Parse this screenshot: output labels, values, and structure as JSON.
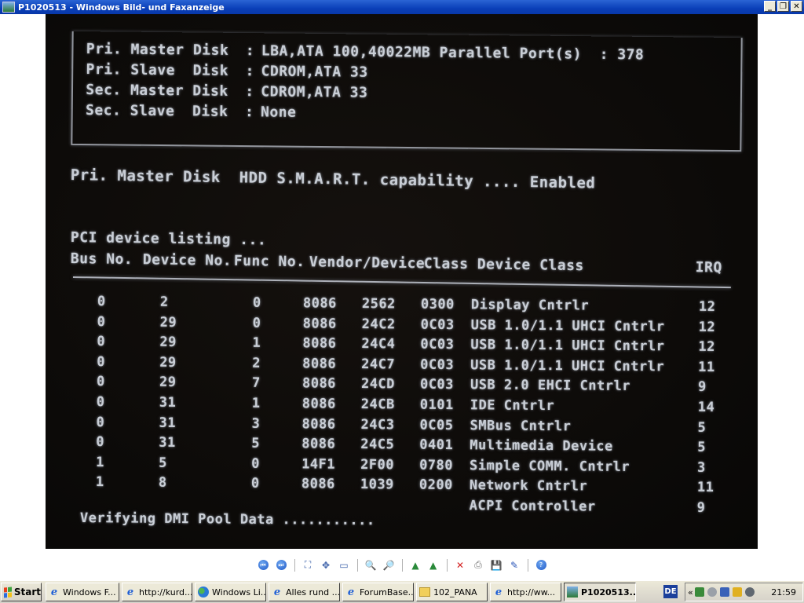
{
  "window": {
    "title": "P1020513 - Windows Bild- und Faxanzeige",
    "buttons": [
      "_",
      "❐",
      "✕"
    ]
  },
  "photo": {
    "disk_rows": [
      {
        "label": "Pri. Master Disk",
        "sep": ":",
        "value": "LBA,ATA 100,40022MB Parallel Port(s)  : 378"
      },
      {
        "label": "Pri. Slave  Disk",
        "sep": ":",
        "value": "CDROM,ATA 33"
      },
      {
        "label": "Sec. Master Disk",
        "sep": ":",
        "value": "CDROM,ATA 33"
      },
      {
        "label": "Sec. Slave  Disk",
        "sep": ":",
        "value": "None"
      }
    ],
    "smart_line": "Pri. Master Disk  HDD S.M.A.R.T. capability .... Enabled",
    "pci_heading": "PCI device listing ...",
    "columns": [
      "Bus No.",
      "Device No.",
      "Func No.",
      "Vendor/Device",
      "Class",
      "Device Class",
      "IRQ"
    ],
    "pci_rows": [
      {
        "bus": "0",
        "dev": "2",
        "func": "0",
        "vendor": "8086",
        "device": "2562",
        "class": "0300",
        "name": "Display Cntrlr",
        "irq": "12"
      },
      {
        "bus": "0",
        "dev": "29",
        "func": "0",
        "vendor": "8086",
        "device": "24C2",
        "class": "0C03",
        "name": "USB 1.0/1.1 UHCI Cntrlr",
        "irq": "12"
      },
      {
        "bus": "0",
        "dev": "29",
        "func": "1",
        "vendor": "8086",
        "device": "24C4",
        "class": "0C03",
        "name": "USB 1.0/1.1 UHCI Cntrlr",
        "irq": "12"
      },
      {
        "bus": "0",
        "dev": "29",
        "func": "2",
        "vendor": "8086",
        "device": "24C7",
        "class": "0C03",
        "name": "USB 1.0/1.1 UHCI Cntrlr",
        "irq": "11"
      },
      {
        "bus": "0",
        "dev": "29",
        "func": "7",
        "vendor": "8086",
        "device": "24CD",
        "class": "0C03",
        "name": "USB 2.0 EHCI Cntrlr",
        "irq": "9"
      },
      {
        "bus": "0",
        "dev": "31",
        "func": "1",
        "vendor": "8086",
        "device": "24CB",
        "class": "0101",
        "name": "IDE Cntrlr",
        "irq": "14"
      },
      {
        "bus": "0",
        "dev": "31",
        "func": "3",
        "vendor": "8086",
        "device": "24C3",
        "class": "0C05",
        "name": "SMBus Cntrlr",
        "irq": "5"
      },
      {
        "bus": "0",
        "dev": "31",
        "func": "5",
        "vendor": "8086",
        "device": "24C5",
        "class": "0401",
        "name": "Multimedia Device",
        "irq": "5"
      },
      {
        "bus": "1",
        "dev": "5",
        "func": "0",
        "vendor": "14F1",
        "device": "2F00",
        "class": "0780",
        "name": "Simple COMM. Cntrlr",
        "irq": "3"
      },
      {
        "bus": "1",
        "dev": "8",
        "func": "0",
        "vendor": "8086",
        "device": "1039",
        "class": "0200",
        "name": "Network Cntrlr",
        "irq": "11"
      },
      {
        "bus": "",
        "dev": "",
        "func": "",
        "vendor": "",
        "device": "",
        "class": "",
        "name": "ACPI Controller",
        "irq": "9"
      }
    ],
    "verify_line": "Verifying DMI Pool Data ..........."
  },
  "viewer_toolbar": {
    "icons": [
      {
        "name": "previous-image-icon",
        "glyph": "⏮"
      },
      {
        "name": "next-image-icon",
        "glyph": "⏭"
      },
      {
        "sep": true
      },
      {
        "name": "best-fit-icon",
        "glyph": "⛶"
      },
      {
        "name": "actual-size-icon",
        "glyph": "✥"
      },
      {
        "name": "slideshow-icon",
        "glyph": "▭"
      },
      {
        "sep": true
      },
      {
        "name": "zoom-in-icon",
        "glyph": "🔍"
      },
      {
        "name": "zoom-out-icon",
        "glyph": "🔎"
      },
      {
        "sep": true
      },
      {
        "name": "rotate-clockwise-icon",
        "glyph": "▲"
      },
      {
        "name": "rotate-counterclockwise-icon",
        "glyph": "▲"
      },
      {
        "sep": true
      },
      {
        "name": "delete-icon",
        "glyph": "✕"
      },
      {
        "name": "print-icon",
        "glyph": "⎙"
      },
      {
        "name": "save-icon",
        "glyph": "💾"
      },
      {
        "name": "edit-icon",
        "glyph": "✎"
      },
      {
        "sep": true
      },
      {
        "name": "help-icon",
        "glyph": "?"
      }
    ]
  },
  "taskbar": {
    "start_label": "Start",
    "tasks": [
      {
        "label": "Windows F...",
        "icon": "ie",
        "width": 94
      },
      {
        "label": "http://kurd...",
        "icon": "ie",
        "width": 90
      },
      {
        "label": "Windows Li...",
        "icon": "msn",
        "width": 91
      },
      {
        "label": "Alles rund ...",
        "icon": "ie",
        "width": 91
      },
      {
        "label": "ForumBase...",
        "icon": "ie",
        "width": 91
      },
      {
        "label": "102_PANA",
        "icon": "folder",
        "width": 91
      },
      {
        "label": "http://ww...",
        "icon": "ie",
        "width": 91
      },
      {
        "label": "P1020513...",
        "icon": "viewer",
        "width": 92,
        "active": true
      }
    ],
    "language": "DE",
    "tray_arrow": "«",
    "clock": "21:59"
  },
  "colors": {
    "titlebar": "#0a3fb8",
    "screen_text": "#c9ced6",
    "photo_bg": "#0d0b09"
  }
}
